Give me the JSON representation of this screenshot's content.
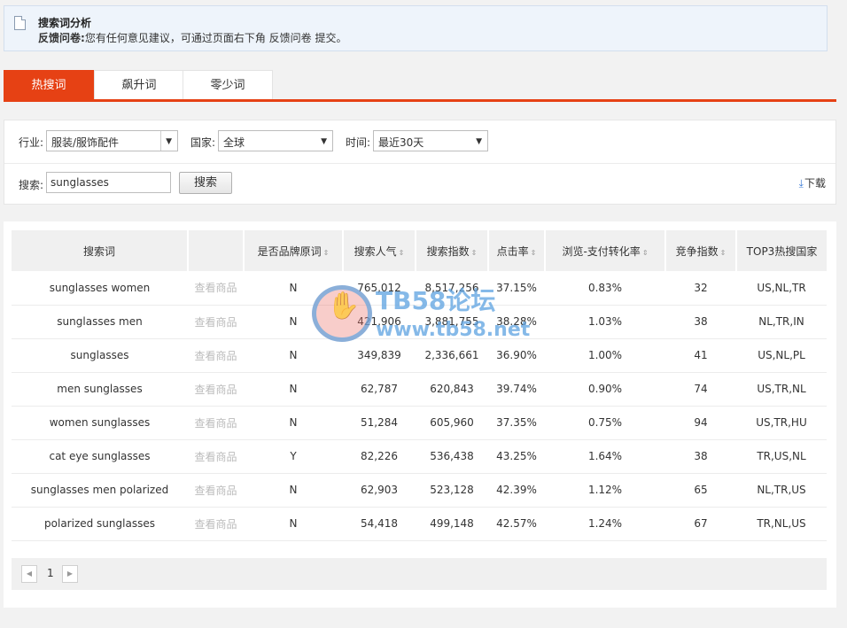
{
  "notice": {
    "title": "搜索词分析",
    "feedback_label": "反馈问卷:",
    "feedback_text": "您有任何意见建议，可通过页面右下角 反馈问卷 提交。"
  },
  "tabs": [
    {
      "label": "热搜词",
      "active": true
    },
    {
      "label": "飙升词",
      "active": false
    },
    {
      "label": "零少词",
      "active": false
    }
  ],
  "filters": {
    "industry_label": "行业:",
    "industry_value": "服装/服饰配件",
    "country_label": "国家:",
    "country_value": "全球",
    "time_label": "时间:",
    "time_value": "最近30天",
    "search_label": "搜索:",
    "search_value": "sunglasses",
    "search_button": "搜索",
    "download": "下载"
  },
  "table": {
    "headers": [
      "搜索词",
      "是否品牌原词",
      "搜索人气",
      "搜索指数",
      "点击率",
      "浏览-支付转化率",
      "竞争指数",
      "TOP3热搜国家"
    ],
    "view_label": "查看商品",
    "rows": [
      {
        "term": "sunglasses women",
        "brand": "N",
        "popularity": "765,012",
        "index": "8,517,256",
        "ctr": "37.15%",
        "conv": "0.83%",
        "compete": "32",
        "countries": "US,NL,TR"
      },
      {
        "term": "sunglasses men",
        "brand": "N",
        "popularity": "421,906",
        "index": "3,881,755",
        "ctr": "38.28%",
        "conv": "1.03%",
        "compete": "38",
        "countries": "NL,TR,IN"
      },
      {
        "term": "sunglasses",
        "brand": "N",
        "popularity": "349,839",
        "index": "2,336,661",
        "ctr": "36.90%",
        "conv": "1.00%",
        "compete": "41",
        "countries": "US,NL,PL"
      },
      {
        "term": "men sunglasses",
        "brand": "N",
        "popularity": "62,787",
        "index": "620,843",
        "ctr": "39.74%",
        "conv": "0.90%",
        "compete": "74",
        "countries": "US,TR,NL"
      },
      {
        "term": "women sunglasses",
        "brand": "N",
        "popularity": "51,284",
        "index": "605,960",
        "ctr": "37.35%",
        "conv": "0.75%",
        "compete": "94",
        "countries": "US,TR,HU"
      },
      {
        "term": "cat eye sunglasses",
        "brand": "Y",
        "popularity": "82,226",
        "index": "536,438",
        "ctr": "43.25%",
        "conv": "1.64%",
        "compete": "38",
        "countries": "TR,US,NL"
      },
      {
        "term": "sunglasses men polarized",
        "brand": "N",
        "popularity": "62,903",
        "index": "523,128",
        "ctr": "42.39%",
        "conv": "1.12%",
        "compete": "65",
        "countries": "NL,TR,US"
      },
      {
        "term": "polarized sunglasses",
        "brand": "N",
        "popularity": "54,418",
        "index": "499,148",
        "ctr": "42.57%",
        "conv": "1.24%",
        "compete": "67",
        "countries": "TR,NL,US"
      }
    ]
  },
  "pager": {
    "current": "1"
  },
  "watermark": {
    "title": "TB58论坛",
    "url": "www.tb58.net"
  },
  "colors": {
    "accent": "#e64114",
    "notice_bg": "#eef4fb"
  }
}
